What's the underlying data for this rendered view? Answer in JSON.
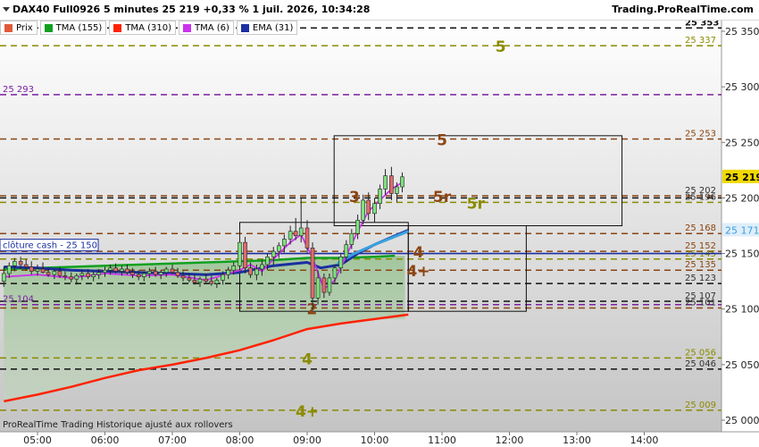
{
  "header": {
    "title": "DAX40 Full0926 5 minutes 25 219 +0,33 % 1 juil. 2026, 10:34:28",
    "site": "Trading.ProRealTime.com"
  },
  "legend": [
    {
      "label": "Prix",
      "color": "#e05a3a"
    },
    {
      "label": "TMA (155)",
      "color": "#10a020"
    },
    {
      "label": "TMA (310)",
      "color": "#ff2200"
    },
    {
      "label": "TMA (6)",
      "color": "#cc33ee"
    },
    {
      "label": "EMA (31)",
      "color": "#1a2fa0"
    }
  ],
  "footer": "ProRealTime Trading  Historique ajusté aux rollovers",
  "close_label": "clôture cash -  25 150",
  "chart_data": {
    "type": "candlestick",
    "yrange": [
      24995,
      25360
    ],
    "y_ticks": [
      25000,
      25050,
      25100,
      25150,
      25200,
      25250,
      25300,
      25350
    ],
    "y_tick_labels": [
      "25 000",
      "25 050",
      "25 100",
      "25 150",
      "25 200",
      "25 250",
      "25 300",
      "25 350"
    ],
    "x_ticks": [
      "05:00",
      "06:00",
      "07:00",
      "08:00",
      "09:00",
      "10:00",
      "11:00",
      "12:00",
      "13:00",
      "14:00"
    ],
    "current_price": {
      "value": 25219,
      "label": "25 219",
      "color": "#f0d800"
    },
    "ema_price": {
      "value": 25171,
      "label": "25 171",
      "color": "#3aa0e0"
    },
    "close_cash": 25150,
    "levels": [
      {
        "value": 25353,
        "label": "25 353",
        "color": "#111111",
        "label_color": "#111111",
        "bold": true
      },
      {
        "value": 25337,
        "label": "25 337",
        "color": "#8b8b00",
        "label_color": "#8b8b00"
      },
      {
        "value": 25293,
        "label": "25 293",
        "color": "#7b1fa2",
        "label_color": "#7b1fa2",
        "left": true
      },
      {
        "value": 25253,
        "label": "25 253",
        "color": "#8b4513",
        "label_color": "#8b4513"
      },
      {
        "value": 25202,
        "label": "25 202",
        "color": "#8b4513",
        "label_color": "#333333"
      },
      {
        "value": 25200,
        "label": "",
        "color": "#111111",
        "label_color": "#333333"
      },
      {
        "value": 25196,
        "label": "25 196",
        "color": "#8b8b00",
        "label_color": "#333333"
      },
      {
        "value": 25168,
        "label": "25 168",
        "color": "#8b4513",
        "label_color": "#8b4513"
      },
      {
        "value": 25152,
        "label": "25 152",
        "color": "#8b4513",
        "label_color": "#8b4513"
      },
      {
        "value": 25145,
        "label": "25 145",
        "color": "#8b8b00",
        "label_color": "#8b8b00"
      },
      {
        "value": 25135,
        "label": "25 135",
        "color": "#8b4513",
        "label_color": "#8b4513"
      },
      {
        "value": 25123,
        "label": "25 123",
        "color": "#111111",
        "label_color": "#333333"
      },
      {
        "value": 25107,
        "label": "25 107",
        "color": "#111111",
        "label_color": "#333333"
      },
      {
        "value": 25104,
        "label": "25 104",
        "color": "#7b1fa2",
        "label_color": "#7b1fa2",
        "left": true
      },
      {
        "value": 25101,
        "label": "25 101",
        "color": "#8b4513",
        "label_color": "#333333"
      },
      {
        "value": 25056,
        "label": "25 056",
        "color": "#8b8b00",
        "label_color": "#8b8b00"
      },
      {
        "value": 25046,
        "label": "25 046",
        "color": "#111111",
        "label_color": "#333333"
      },
      {
        "value": 25009,
        "label": "25 009",
        "color": "#8b8b00",
        "label_color": "#8b8b00"
      }
    ],
    "annotations": [
      {
        "text": "5",
        "value": 25337,
        "time": 11.87,
        "color": "#8b8b00"
      },
      {
        "text": "5",
        "value": 25253,
        "time": 11.0,
        "color": "#8b4513"
      },
      {
        "text": "3",
        "value": 25202,
        "time": 9.7,
        "color": "#8b4513"
      },
      {
        "text": "5r",
        "value": 25202,
        "time": 11.0,
        "color": "#8b4513"
      },
      {
        "text": "5r",
        "value": 25196,
        "time": 11.5,
        "color": "#8b8b00"
      },
      {
        "text": "4",
        "value": 25152,
        "time": 10.65,
        "color": "#8b4513"
      },
      {
        "text": "4+",
        "value": 25135,
        "time": 10.65,
        "color": "#8b4513"
      },
      {
        "text": "2",
        "value": 25101,
        "time": 9.07,
        "color": "#8b4513"
      },
      {
        "text": "4",
        "value": 25056,
        "time": 9.0,
        "color": "#8b8b00"
      },
      {
        "text": "4+",
        "value": 25009,
        "time": 9.0,
        "color": "#8b8b00"
      }
    ],
    "boxes": [
      {
        "t1": 8.0,
        "t2": 10.5,
        "v1": 25178,
        "v2": 25098
      },
      {
        "t1": 9.4,
        "t2": 13.67,
        "v1": 25256,
        "v2": 25175
      },
      {
        "t1": 10.5,
        "t2": 12.25,
        "v1": 25175,
        "v2": 25098
      }
    ],
    "candles": [
      {
        "t": 4.5,
        "o": 25125,
        "h": 25138,
        "l": 25120,
        "c": 25132
      },
      {
        "t": 4.58,
        "o": 25132,
        "h": 25142,
        "l": 25128,
        "c": 25139
      },
      {
        "t": 4.66,
        "o": 25139,
        "h": 25146,
        "l": 25134,
        "c": 25143
      },
      {
        "t": 4.75,
        "o": 25143,
        "h": 25147,
        "l": 25136,
        "c": 25140
      },
      {
        "t": 4.83,
        "o": 25140,
        "h": 25145,
        "l": 25135,
        "c": 25138
      },
      {
        "t": 4.91,
        "o": 25138,
        "h": 25143,
        "l": 25131,
        "c": 25134
      },
      {
        "t": 5.0,
        "o": 25134,
        "h": 25140,
        "l": 25130,
        "c": 25136
      },
      {
        "t": 5.08,
        "o": 25136,
        "h": 25142,
        "l": 25132,
        "c": 25133
      },
      {
        "t": 5.16,
        "o": 25133,
        "h": 25137,
        "l": 25129,
        "c": 25131
      },
      {
        "t": 5.25,
        "o": 25131,
        "h": 25136,
        "l": 25127,
        "c": 25134
      },
      {
        "t": 5.33,
        "o": 25134,
        "h": 25138,
        "l": 25128,
        "c": 25130
      },
      {
        "t": 5.41,
        "o": 25130,
        "h": 25134,
        "l": 25126,
        "c": 25129
      },
      {
        "t": 5.5,
        "o": 25129,
        "h": 25133,
        "l": 25124,
        "c": 25127
      },
      {
        "t": 5.58,
        "o": 25127,
        "h": 25132,
        "l": 25122,
        "c": 25130
      },
      {
        "t": 5.66,
        "o": 25130,
        "h": 25135,
        "l": 25126,
        "c": 25132
      },
      {
        "t": 5.75,
        "o": 25132,
        "h": 25136,
        "l": 25127,
        "c": 25129
      },
      {
        "t": 5.83,
        "o": 25129,
        "h": 25134,
        "l": 25125,
        "c": 25131
      },
      {
        "t": 5.91,
        "o": 25131,
        "h": 25136,
        "l": 25127,
        "c": 25133
      },
      {
        "t": 6.0,
        "o": 25133,
        "h": 25138,
        "l": 25129,
        "c": 25135
      },
      {
        "t": 6.08,
        "o": 25135,
        "h": 25140,
        "l": 25131,
        "c": 25137
      },
      {
        "t": 6.16,
        "o": 25137,
        "h": 25141,
        "l": 25132,
        "c": 25134
      },
      {
        "t": 6.25,
        "o": 25134,
        "h": 25139,
        "l": 25130,
        "c": 25136
      },
      {
        "t": 6.33,
        "o": 25136,
        "h": 25140,
        "l": 25131,
        "c": 25133
      },
      {
        "t": 6.41,
        "o": 25133,
        "h": 25137,
        "l": 25128,
        "c": 25131
      },
      {
        "t": 6.5,
        "o": 25131,
        "h": 25135,
        "l": 25126,
        "c": 25129
      },
      {
        "t": 6.58,
        "o": 25129,
        "h": 25134,
        "l": 25125,
        "c": 25132
      },
      {
        "t": 6.66,
        "o": 25132,
        "h": 25137,
        "l": 25128,
        "c": 25134
      },
      {
        "t": 6.75,
        "o": 25134,
        "h": 25138,
        "l": 25129,
        "c": 25131
      },
      {
        "t": 6.83,
        "o": 25131,
        "h": 25135,
        "l": 25127,
        "c": 25133
      },
      {
        "t": 6.91,
        "o": 25133,
        "h": 25138,
        "l": 25129,
        "c": 25136
      },
      {
        "t": 7.0,
        "o": 25136,
        "h": 25140,
        "l": 25131,
        "c": 25133
      },
      {
        "t": 7.08,
        "o": 25133,
        "h": 25137,
        "l": 25128,
        "c": 25130
      },
      {
        "t": 7.16,
        "o": 25130,
        "h": 25134,
        "l": 25125,
        "c": 25128
      },
      {
        "t": 7.25,
        "o": 25128,
        "h": 25132,
        "l": 25124,
        "c": 25126
      },
      {
        "t": 7.33,
        "o": 25126,
        "h": 25131,
        "l": 25122,
        "c": 25124
      },
      {
        "t": 7.41,
        "o": 25124,
        "h": 25129,
        "l": 25120,
        "c": 25127
      },
      {
        "t": 7.5,
        "o": 25127,
        "h": 25132,
        "l": 25123,
        "c": 25125
      },
      {
        "t": 7.58,
        "o": 25125,
        "h": 25130,
        "l": 25121,
        "c": 25123
      },
      {
        "t": 7.66,
        "o": 25123,
        "h": 25128,
        "l": 25119,
        "c": 25126
      },
      {
        "t": 7.75,
        "o": 25126,
        "h": 25134,
        "l": 25122,
        "c": 25131
      },
      {
        "t": 7.83,
        "o": 25131,
        "h": 25138,
        "l": 25127,
        "c": 25135
      },
      {
        "t": 7.91,
        "o": 25135,
        "h": 25142,
        "l": 25131,
        "c": 25139
      },
      {
        "t": 8.0,
        "o": 25139,
        "h": 25172,
        "l": 25135,
        "c": 25160
      },
      {
        "t": 8.08,
        "o": 25160,
        "h": 25165,
        "l": 25132,
        "c": 25137
      },
      {
        "t": 8.16,
        "o": 25137,
        "h": 25142,
        "l": 25128,
        "c": 25131
      },
      {
        "t": 8.25,
        "o": 25131,
        "h": 25140,
        "l": 25126,
        "c": 25136
      },
      {
        "t": 8.33,
        "o": 25136,
        "h": 25144,
        "l": 25130,
        "c": 25140
      },
      {
        "t": 8.41,
        "o": 25140,
        "h": 25150,
        "l": 25135,
        "c": 25147
      },
      {
        "t": 8.5,
        "o": 25147,
        "h": 25156,
        "l": 25140,
        "c": 25152
      },
      {
        "t": 8.58,
        "o": 25152,
        "h": 25160,
        "l": 25146,
        "c": 25157
      },
      {
        "t": 8.66,
        "o": 25157,
        "h": 25167,
        "l": 25151,
        "c": 25163
      },
      {
        "t": 8.75,
        "o": 25163,
        "h": 25175,
        "l": 25158,
        "c": 25170
      },
      {
        "t": 8.83,
        "o": 25170,
        "h": 25182,
        "l": 25162,
        "c": 25166
      },
      {
        "t": 8.91,
        "o": 25166,
        "h": 25200,
        "l": 25160,
        "c": 25173
      },
      {
        "t": 9.0,
        "o": 25173,
        "h": 25180,
        "l": 25150,
        "c": 25155
      },
      {
        "t": 9.08,
        "o": 25155,
        "h": 25160,
        "l": 25100,
        "c": 25110
      },
      {
        "t": 9.16,
        "o": 25110,
        "h": 25135,
        "l": 25104,
        "c": 25128
      },
      {
        "t": 9.25,
        "o": 25128,
        "h": 25132,
        "l": 25110,
        "c": 25115
      },
      {
        "t": 9.33,
        "o": 25115,
        "h": 25132,
        "l": 25112,
        "c": 25128
      },
      {
        "t": 9.41,
        "o": 25128,
        "h": 25140,
        "l": 25124,
        "c": 25137
      },
      {
        "t": 9.5,
        "o": 25137,
        "h": 25150,
        "l": 25132,
        "c": 25147
      },
      {
        "t": 9.58,
        "o": 25147,
        "h": 25162,
        "l": 25142,
        "c": 25158
      },
      {
        "t": 9.66,
        "o": 25158,
        "h": 25172,
        "l": 25154,
        "c": 25168
      },
      {
        "t": 9.75,
        "o": 25168,
        "h": 25185,
        "l": 25163,
        "c": 25180
      },
      {
        "t": 9.83,
        "o": 25180,
        "h": 25203,
        "l": 25176,
        "c": 25198
      },
      {
        "t": 9.91,
        "o": 25198,
        "h": 25205,
        "l": 25180,
        "c": 25186
      },
      {
        "t": 10.0,
        "o": 25186,
        "h": 25200,
        "l": 25178,
        "c": 25195
      },
      {
        "t": 10.08,
        "o": 25195,
        "h": 25212,
        "l": 25190,
        "c": 25208
      },
      {
        "t": 10.16,
        "o": 25208,
        "h": 25226,
        "l": 25203,
        "c": 25220
      },
      {
        "t": 10.25,
        "o": 25220,
        "h": 25228,
        "l": 25198,
        "c": 25204
      },
      {
        "t": 10.33,
        "o": 25204,
        "h": 25214,
        "l": 25196,
        "c": 25210
      },
      {
        "t": 10.41,
        "o": 25210,
        "h": 25223,
        "l": 25205,
        "c": 25219
      }
    ],
    "tma6": [
      [
        4.5,
        25129
      ],
      [
        5.0,
        25131
      ],
      [
        5.5,
        25128
      ],
      [
        6.0,
        25132
      ],
      [
        6.5,
        25130
      ],
      [
        7.0,
        25131
      ],
      [
        7.5,
        25126
      ],
      [
        8.0,
        25135
      ],
      [
        8.16,
        25140
      ],
      [
        8.33,
        25134
      ],
      [
        8.5,
        25145
      ],
      [
        8.75,
        25160
      ],
      [
        8.91,
        25167
      ],
      [
        9.08,
        25146
      ],
      [
        9.25,
        25118
      ],
      [
        9.41,
        25126
      ],
      [
        9.58,
        25148
      ],
      [
        9.75,
        25170
      ],
      [
        9.91,
        25188
      ],
      [
        10.08,
        25198
      ],
      [
        10.25,
        25208
      ],
      [
        10.41,
        25214
      ]
    ],
    "tma155": [
      [
        4.5,
        25136
      ],
      [
        5.0,
        25137
      ],
      [
        5.5,
        25138
      ],
      [
        6.0,
        25139
      ],
      [
        6.5,
        25140
      ],
      [
        7.0,
        25141
      ],
      [
        7.5,
        25142
      ],
      [
        8.0,
        25143
      ],
      [
        8.5,
        25144
      ],
      [
        9.0,
        25146
      ],
      [
        9.5,
        25146
      ],
      [
        10.0,
        25147
      ],
      [
        10.3,
        25148
      ]
    ],
    "tma310": [
      [
        4.5,
        25017
      ],
      [
        5.0,
        25023
      ],
      [
        5.5,
        25030
      ],
      [
        6.0,
        25038
      ],
      [
        6.5,
        25045
      ],
      [
        7.0,
        25050
      ],
      [
        7.5,
        25056
      ],
      [
        8.0,
        25063
      ],
      [
        8.5,
        25072
      ],
      [
        9.0,
        25082
      ],
      [
        9.5,
        25087
      ],
      [
        10.0,
        25091
      ],
      [
        10.5,
        25095
      ]
    ],
    "ema31": [
      [
        4.5,
        25138
      ],
      [
        5.0,
        25137
      ],
      [
        5.5,
        25135
      ],
      [
        6.0,
        25134
      ],
      [
        6.5,
        25133
      ],
      [
        7.0,
        25132
      ],
      [
        7.5,
        25131
      ],
      [
        8.0,
        25133
      ],
      [
        8.5,
        25139
      ],
      [
        9.0,
        25142
      ],
      [
        9.2,
        25137
      ],
      [
        9.5,
        25140
      ],
      [
        9.75,
        25150
      ],
      [
        10.0,
        25158
      ],
      [
        10.3,
        25166
      ],
      [
        10.5,
        25171
      ]
    ],
    "cyan": [
      [
        9.45,
        25141
      ],
      [
        9.7,
        25150
      ],
      [
        10.0,
        25158
      ],
      [
        10.25,
        25164
      ],
      [
        10.5,
        25170
      ]
    ]
  }
}
